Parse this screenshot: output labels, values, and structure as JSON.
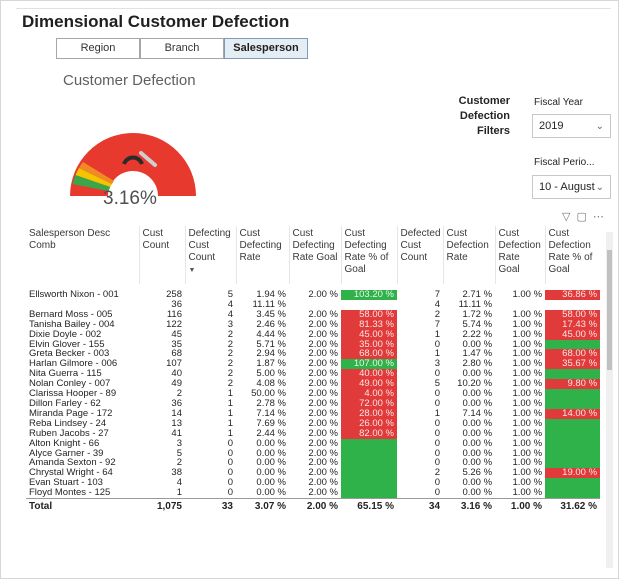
{
  "page": {
    "title": "Dimensional Customer Defection"
  },
  "tabs": [
    {
      "label": "Region",
      "active": false
    },
    {
      "label": "Branch",
      "active": false
    },
    {
      "label": "Salesperson",
      "active": true
    }
  ],
  "gauge": {
    "title": "Customer Defection",
    "value_label": "3.16%",
    "colors": {
      "red": "#e8392f",
      "yellow": "#f5c400",
      "orange": "#f08a24",
      "green": "#3aa64a",
      "needle": "#2b2b2b"
    }
  },
  "filters": {
    "label": "Customer Defection Filters",
    "fiscal_year": {
      "label": "Fiscal Year",
      "value": "2019"
    },
    "fiscal_period": {
      "label": "Fiscal Perio...",
      "value": "10 - August"
    }
  },
  "toolbar_icons": [
    "filter-icon",
    "focus-mode-icon",
    "more-options-icon"
  ],
  "table": {
    "columns": [
      "Salesperson Desc Comb",
      "Cust Count",
      "Defecting Cust Count",
      "Cust Defecting Rate",
      "Cust Defecting Rate Goal",
      "Cust Defecting Rate % of Goal",
      "Defected Cust Count",
      "Cust Defection Rate",
      "Cust Defection Rate Goal",
      "Cust Defection Rate % of Goal"
    ],
    "rows": [
      {
        "name": "Ellsworth Nixon - 001",
        "cust": "258",
        "dcc": "5",
        "dr": "1.94 %",
        "drg": "2.00 %",
        "dpg": "103.20 %",
        "dpg_color": "green",
        "dfc": "7",
        "dfr": "2.71 %",
        "dfg": "1.00 %",
        "dfp": "36.86 %",
        "dfp_color": "red"
      },
      {
        "name": "",
        "cust": "36",
        "dcc": "4",
        "dr": "11.11 %",
        "drg": "",
        "dpg": "",
        "dpg_color": "",
        "dfc": "4",
        "dfr": "11.11 %",
        "dfg": "",
        "dfp": "",
        "dfp_color": ""
      },
      {
        "name": "Bernard Moss - 005",
        "cust": "116",
        "dcc": "4",
        "dr": "3.45 %",
        "drg": "2.00 %",
        "dpg": "58.00 %",
        "dpg_color": "red",
        "dfc": "2",
        "dfr": "1.72 %",
        "dfg": "1.00 %",
        "dfp": "58.00 %",
        "dfp_color": "red"
      },
      {
        "name": "Tanisha Bailey - 004",
        "cust": "122",
        "dcc": "3",
        "dr": "2.46 %",
        "drg": "2.00 %",
        "dpg": "81.33 %",
        "dpg_color": "red",
        "dfc": "7",
        "dfr": "5.74 %",
        "dfg": "1.00 %",
        "dfp": "17.43 %",
        "dfp_color": "red"
      },
      {
        "name": "Dixie Doyle - 002",
        "cust": "45",
        "dcc": "2",
        "dr": "4.44 %",
        "drg": "2.00 %",
        "dpg": "45.00 %",
        "dpg_color": "red",
        "dfc": "1",
        "dfr": "2.22 %",
        "dfg": "1.00 %",
        "dfp": "45.00 %",
        "dfp_color": "red"
      },
      {
        "name": "Elvin Glover - 155",
        "cust": "35",
        "dcc": "2",
        "dr": "5.71 %",
        "drg": "2.00 %",
        "dpg": "35.00 %",
        "dpg_color": "red",
        "dfc": "0",
        "dfr": "0.00 %",
        "dfg": "1.00 %",
        "dfp": "",
        "dfp_color": "green"
      },
      {
        "name": "Greta Becker - 003",
        "cust": "68",
        "dcc": "2",
        "dr": "2.94 %",
        "drg": "2.00 %",
        "dpg": "68.00 %",
        "dpg_color": "red",
        "dfc": "1",
        "dfr": "1.47 %",
        "dfg": "1.00 %",
        "dfp": "68.00 %",
        "dfp_color": "red"
      },
      {
        "name": "Harlan Gilmore - 006",
        "cust": "107",
        "dcc": "2",
        "dr": "1.87 %",
        "drg": "2.00 %",
        "dpg": "107.00 %",
        "dpg_color": "green",
        "dfc": "3",
        "dfr": "2.80 %",
        "dfg": "1.00 %",
        "dfp": "35.67 %",
        "dfp_color": "red"
      },
      {
        "name": "Nita Guerra - 115",
        "cust": "40",
        "dcc": "2",
        "dr": "5.00 %",
        "drg": "2.00 %",
        "dpg": "40.00 %",
        "dpg_color": "red",
        "dfc": "0",
        "dfr": "0.00 %",
        "dfg": "1.00 %",
        "dfp": "",
        "dfp_color": "green"
      },
      {
        "name": "Nolan Conley - 007",
        "cust": "49",
        "dcc": "2",
        "dr": "4.08 %",
        "drg": "2.00 %",
        "dpg": "49.00 %",
        "dpg_color": "red",
        "dfc": "5",
        "dfr": "10.20 %",
        "dfg": "1.00 %",
        "dfp": "9.80 %",
        "dfp_color": "red"
      },
      {
        "name": "Clarissa Hooper - 89",
        "cust": "2",
        "dcc": "1",
        "dr": "50.00 %",
        "drg": "2.00 %",
        "dpg": "4.00 %",
        "dpg_color": "red",
        "dfc": "0",
        "dfr": "0.00 %",
        "dfg": "1.00 %",
        "dfp": "",
        "dfp_color": "green"
      },
      {
        "name": "Dillon Farley - 62",
        "cust": "36",
        "dcc": "1",
        "dr": "2.78 %",
        "drg": "2.00 %",
        "dpg": "72.00 %",
        "dpg_color": "red",
        "dfc": "0",
        "dfr": "0.00 %",
        "dfg": "1.00 %",
        "dfp": "",
        "dfp_color": "green"
      },
      {
        "name": "Miranda Page - 172",
        "cust": "14",
        "dcc": "1",
        "dr": "7.14 %",
        "drg": "2.00 %",
        "dpg": "28.00 %",
        "dpg_color": "red",
        "dfc": "1",
        "dfr": "7.14 %",
        "dfg": "1.00 %",
        "dfp": "14.00 %",
        "dfp_color": "red"
      },
      {
        "name": "Reba Lindsey - 24",
        "cust": "13",
        "dcc": "1",
        "dr": "7.69 %",
        "drg": "2.00 %",
        "dpg": "26.00 %",
        "dpg_color": "red",
        "dfc": "0",
        "dfr": "0.00 %",
        "dfg": "1.00 %",
        "dfp": "",
        "dfp_color": "green"
      },
      {
        "name": "Ruben Jacobs - 27",
        "cust": "41",
        "dcc": "1",
        "dr": "2.44 %",
        "drg": "2.00 %",
        "dpg": "82.00 %",
        "dpg_color": "red",
        "dfc": "0",
        "dfr": "0.00 %",
        "dfg": "1.00 %",
        "dfp": "",
        "dfp_color": "green"
      },
      {
        "name": "Alton Knight - 66",
        "cust": "3",
        "dcc": "0",
        "dr": "0.00 %",
        "drg": "2.00 %",
        "dpg": "",
        "dpg_color": "green",
        "dfc": "0",
        "dfr": "0.00 %",
        "dfg": "1.00 %",
        "dfp": "",
        "dfp_color": "green"
      },
      {
        "name": "Alyce Garner - 39",
        "cust": "5",
        "dcc": "0",
        "dr": "0.00 %",
        "drg": "2.00 %",
        "dpg": "",
        "dpg_color": "green",
        "dfc": "0",
        "dfr": "0.00 %",
        "dfg": "1.00 %",
        "dfp": "",
        "dfp_color": "green"
      },
      {
        "name": "Amanda Sexton - 92",
        "cust": "2",
        "dcc": "0",
        "dr": "0.00 %",
        "drg": "2.00 %",
        "dpg": "",
        "dpg_color": "green",
        "dfc": "0",
        "dfr": "0.00 %",
        "dfg": "1.00 %",
        "dfp": "",
        "dfp_color": "green"
      },
      {
        "name": "Chrystal Wright - 64",
        "cust": "38",
        "dcc": "0",
        "dr": "0.00 %",
        "drg": "2.00 %",
        "dpg": "",
        "dpg_color": "green",
        "dfc": "2",
        "dfr": "5.26 %",
        "dfg": "1.00 %",
        "dfp": "19.00 %",
        "dfp_color": "red"
      },
      {
        "name": "Evan Stuart - 103",
        "cust": "4",
        "dcc": "0",
        "dr": "0.00 %",
        "drg": "2.00 %",
        "dpg": "",
        "dpg_color": "green",
        "dfc": "0",
        "dfr": "0.00 %",
        "dfg": "1.00 %",
        "dfp": "",
        "dfp_color": "green"
      },
      {
        "name": "Floyd Montes - 125",
        "cust": "1",
        "dcc": "0",
        "dr": "0.00 %",
        "drg": "2.00 %",
        "dpg": "",
        "dpg_color": "green",
        "dfc": "0",
        "dfr": "0.00 %",
        "dfg": "1.00 %",
        "dfp": "",
        "dfp_color": "green"
      }
    ],
    "total": {
      "name": "Total",
      "cust": "1,075",
      "dcc": "33",
      "dr": "3.07 %",
      "drg": "2.00 %",
      "dpg": "65.15 %",
      "dfc": "34",
      "dfr": "3.16 %",
      "dfg": "1.00 %",
      "dfp": "31.62 %"
    }
  }
}
